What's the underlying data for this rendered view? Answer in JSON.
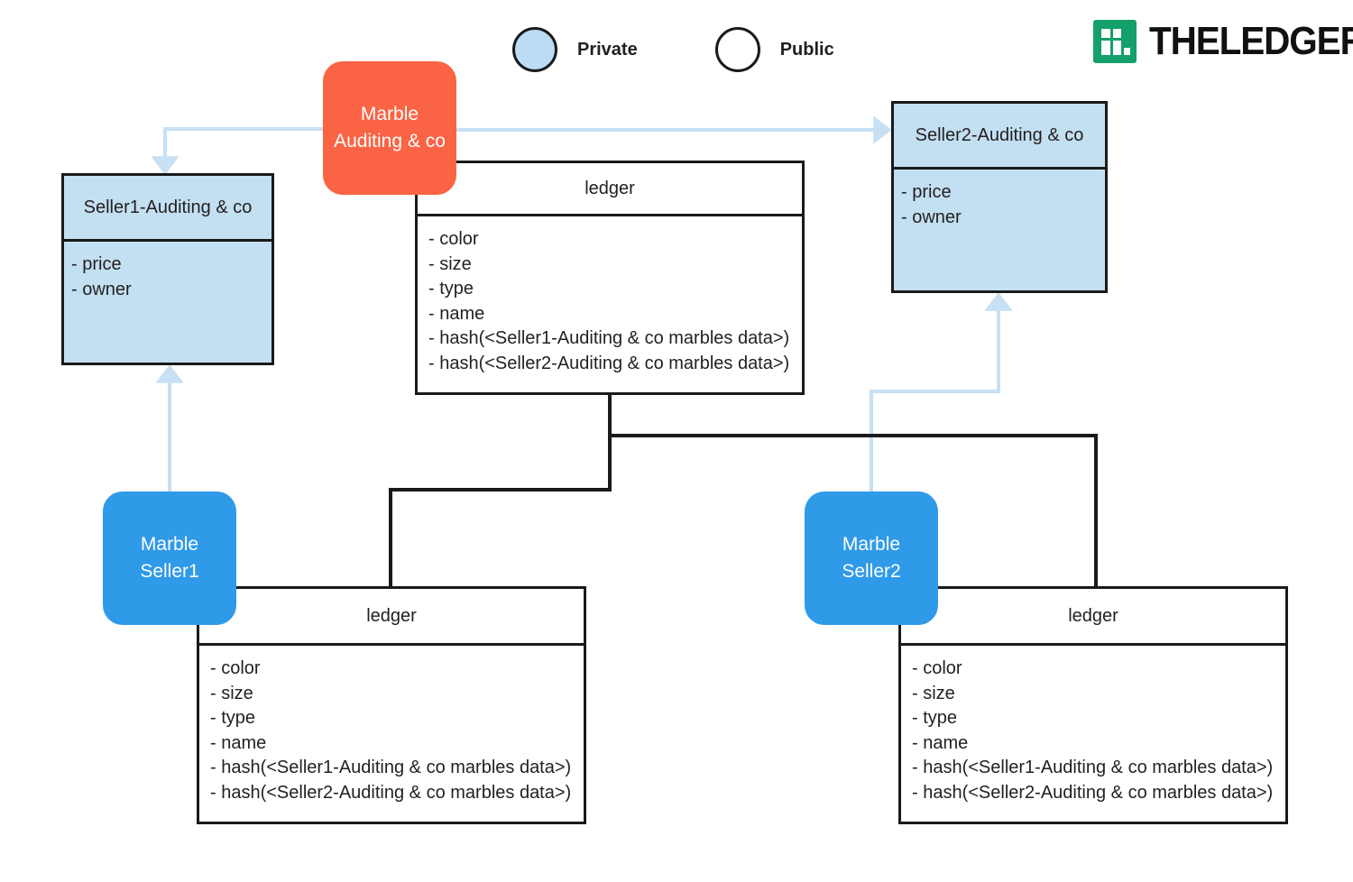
{
  "brand": {
    "name": "THELEDGER.",
    "mark_color": "#13a06a",
    "mark_icon": "ledger-logo-icon"
  },
  "legend": {
    "items": [
      {
        "label": "Private",
        "swatch_color": "#bcdcf5",
        "icon": "filled-circle-icon"
      },
      {
        "label": "Public",
        "swatch_color": "#ffffff",
        "icon": "empty-circle-icon"
      }
    ]
  },
  "colors": {
    "private_fill": "#c3dff2",
    "peer_orange": "#fa6344",
    "peer_blue": "#2f9ae8",
    "arrow_blue": "#c7e0f4",
    "stroke_black": "#1a1a1a"
  },
  "peers": [
    {
      "id": "auditing",
      "line1": "Marble",
      "line2": "Auditing & co",
      "color": "#fa6344"
    },
    {
      "id": "seller1",
      "line1": "Marble",
      "line2": "Seller1",
      "color": "#2f9ae8"
    },
    {
      "id": "seller2",
      "line1": "Marble",
      "line2": "Seller2",
      "color": "#2f9ae8"
    }
  ],
  "collections": {
    "seller1_private": {
      "title": "Seller1-Auditing & co",
      "attributes": [
        "- price",
        "- owner"
      ],
      "visibility": "private"
    },
    "seller2_private": {
      "title": "Seller2-Auditing & co",
      "attributes": [
        "- price",
        "- owner"
      ],
      "visibility": "private"
    },
    "ledger_main": {
      "title": "ledger",
      "attributes": [
        "- color",
        "- size",
        "- type",
        "- name",
        "- hash(<Seller1-Auditing & co marbles data>)",
        "- hash(<Seller2-Auditing & co marbles data>)"
      ],
      "visibility": "public"
    },
    "ledger_seller1": {
      "title": "ledger",
      "attributes": [
        "- color",
        "- size",
        "- type",
        "- name",
        "- hash(<Seller1-Auditing & co marbles data>)",
        "- hash(<Seller2-Auditing & co marbles data>)"
      ],
      "visibility": "public"
    },
    "ledger_seller2": {
      "title": "ledger",
      "attributes": [
        "- color",
        "- size",
        "- type",
        "- name",
        "- hash(<Seller1-Auditing & co marbles data>)",
        "- hash(<Seller2-Auditing & co marbles data>)"
      ],
      "visibility": "public"
    }
  }
}
